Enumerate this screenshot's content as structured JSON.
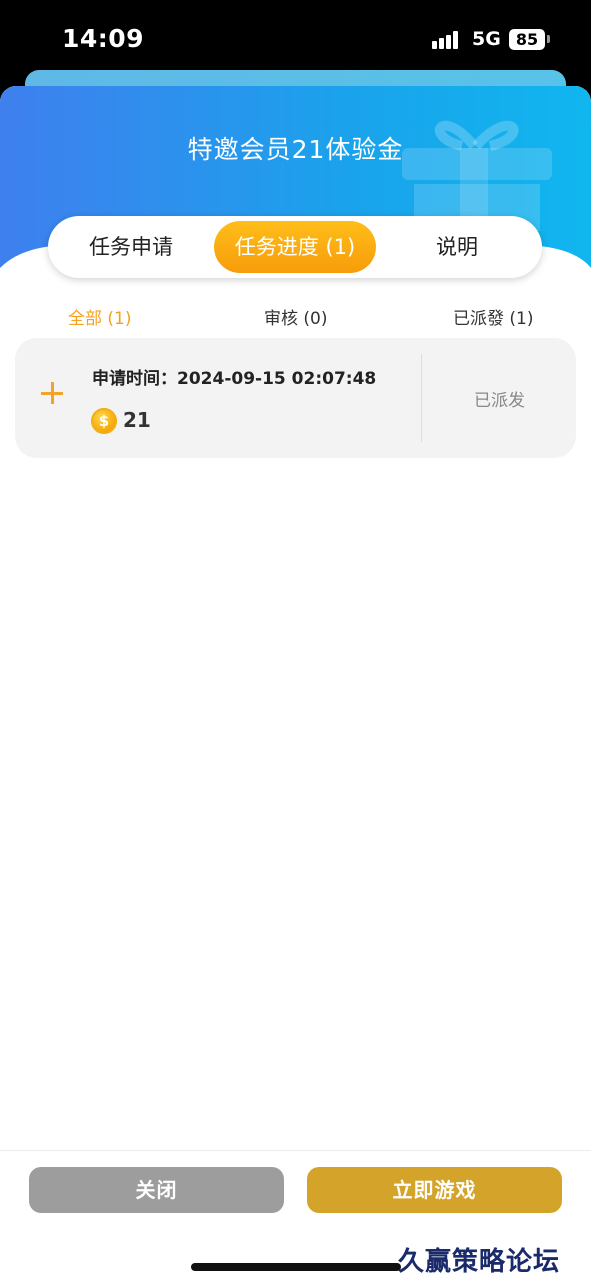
{
  "status_bar": {
    "time": "14:09",
    "network": "5G",
    "battery": "85"
  },
  "modal": {
    "title": "特邀会员21体验金"
  },
  "tabs": [
    {
      "label": "任务申请",
      "active": false
    },
    {
      "label": "任务进度 (1)",
      "active": true
    },
    {
      "label": "说明",
      "active": false
    }
  ],
  "subtabs": [
    {
      "label": "全部 (1)",
      "active": true
    },
    {
      "label": "审核 (0)",
      "active": false
    },
    {
      "label": "已派發 (1)",
      "active": false
    }
  ],
  "record": {
    "apply_time": "申请时间：2024-09-15 02:07:48",
    "coin_symbol": "$",
    "amount": "21",
    "status": "已派发"
  },
  "footer": {
    "close_label": "关闭",
    "play_label": "立即游戏"
  },
  "watermark": "久赢策略论坛",
  "colors": {
    "accent_orange": "#f5a11e",
    "header_blue": "#1aa3ec",
    "play_button": "#d4a42a",
    "close_button": "#9d9d9d"
  },
  "icons": [
    "signal-icon",
    "battery-icon",
    "gift-icon",
    "plus-icon",
    "coin-icon"
  ]
}
